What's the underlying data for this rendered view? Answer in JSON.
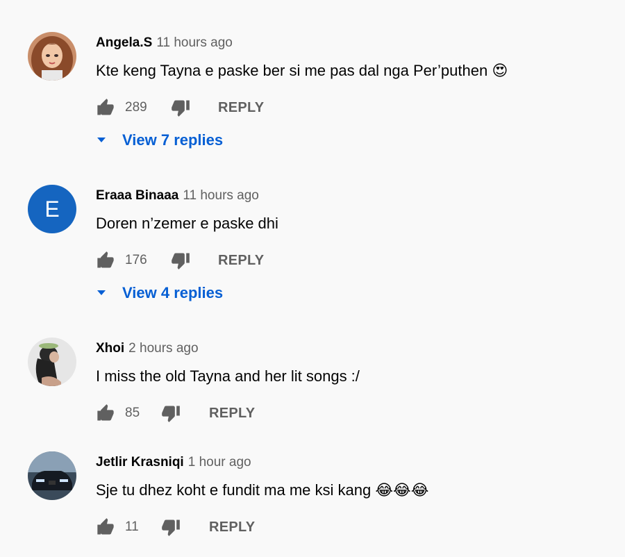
{
  "comments": [
    {
      "author": "Angela.S",
      "time": "11 hours ago",
      "text": "Kte keng Tayna e paske ber si me pas dal nga Per’puthen 😍",
      "likes": "289",
      "reply_label": "REPLY",
      "view_replies": "View 7 replies",
      "avatar_icon": "cartoon-woman-avatar"
    },
    {
      "author": "Eraaa Binaaa",
      "time": "11 hours ago",
      "text": "Doren n’zemer e paske dhi",
      "likes": "176",
      "reply_label": "REPLY",
      "view_replies": "View 4 replies",
      "avatar_letter": "E",
      "avatar_color": "#1565c0"
    },
    {
      "author": "Xhoi",
      "time": "2 hours ago",
      "text": "I miss the old Tayna and her lit songs :/",
      "likes": "85",
      "reply_label": "REPLY",
      "avatar_icon": "photo-avatar"
    },
    {
      "author": "Jetlir Krasniqi",
      "time": "1 hour ago",
      "text": "Sje tu dhez koht e fundit ma me ksi kang 😂😂😂",
      "likes": "11",
      "reply_label": "REPLY",
      "avatar_icon": "car-photo-avatar"
    }
  ],
  "colors": {
    "link": "#065fd4",
    "secondary": "#606060",
    "background": "#f9f9f9"
  }
}
